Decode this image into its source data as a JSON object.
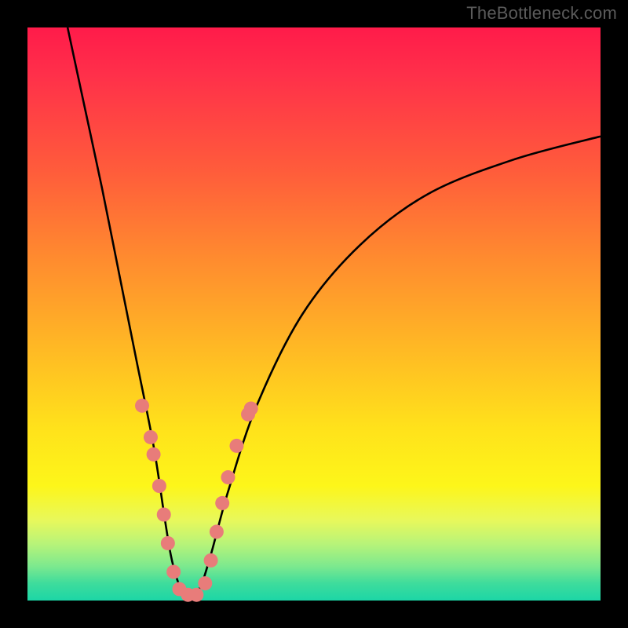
{
  "watermark": "TheBottleneck.com",
  "chart_data": {
    "type": "line",
    "title": "",
    "xlabel": "",
    "ylabel": "",
    "xlim": [
      0,
      100
    ],
    "ylim": [
      0,
      100
    ],
    "series": [
      {
        "name": "curve-left",
        "x": [
          7,
          10,
          13,
          16,
          19,
          22,
          24,
          25,
          26,
          27,
          28
        ],
        "y": [
          100,
          86,
          72,
          57,
          42,
          27,
          14,
          8,
          4,
          1.5,
          0
        ]
      },
      {
        "name": "curve-right",
        "x": [
          28,
          30,
          32,
          35,
          40,
          48,
          58,
          70,
          85,
          100
        ],
        "y": [
          0,
          2,
          8,
          19,
          34,
          50,
          62,
          71,
          77,
          81
        ]
      }
    ],
    "markers": [
      {
        "x": 20.0,
        "y": 34.0
      },
      {
        "x": 21.5,
        "y": 28.5
      },
      {
        "x": 22.0,
        "y": 25.5
      },
      {
        "x": 23.0,
        "y": 20.0
      },
      {
        "x": 23.8,
        "y": 15.0
      },
      {
        "x": 24.5,
        "y": 10.0
      },
      {
        "x": 25.5,
        "y": 5.0
      },
      {
        "x": 26.5,
        "y": 2.0
      },
      {
        "x": 28.0,
        "y": 1.0
      },
      {
        "x": 29.5,
        "y": 1.0
      },
      {
        "x": 31.0,
        "y": 3.0
      },
      {
        "x": 32.0,
        "y": 7.0
      },
      {
        "x": 33.0,
        "y": 12.0
      },
      {
        "x": 34.0,
        "y": 17.0
      },
      {
        "x": 35.0,
        "y": 21.5
      },
      {
        "x": 36.5,
        "y": 27.0
      },
      {
        "x": 38.5,
        "y": 32.5
      },
      {
        "x": 39.0,
        "y": 33.5
      }
    ],
    "marker_style": {
      "color": "#e87c7a",
      "radius_px": 9
    }
  }
}
